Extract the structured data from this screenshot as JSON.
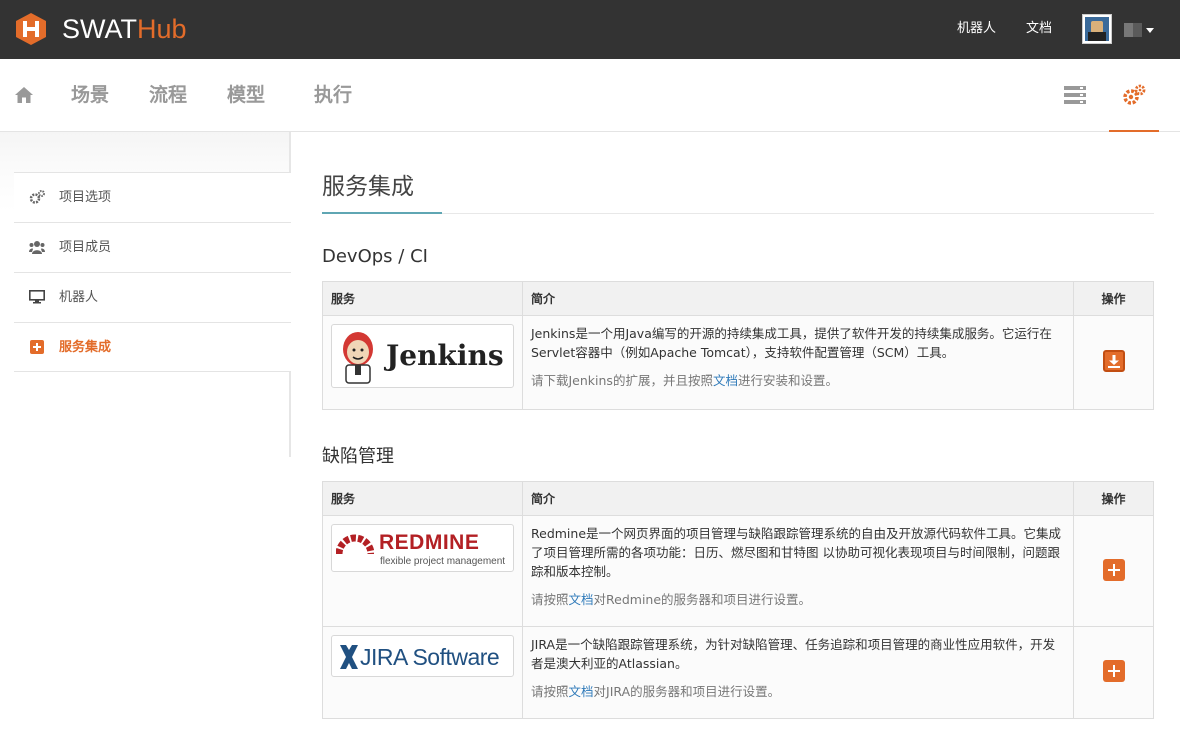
{
  "topbar": {
    "brand_part1": "SWAT",
    "brand_part2": "Hub",
    "link_robot": "机器人",
    "link_docs": "文档"
  },
  "mainnav": {
    "items": [
      "场景",
      "流程",
      "模型",
      "执行"
    ]
  },
  "sidebar": {
    "items": [
      {
        "label": "项目选项",
        "icon": "cogs-icon"
      },
      {
        "label": "项目成员",
        "icon": "users-icon"
      },
      {
        "label": "机器人",
        "icon": "desktop-icon"
      },
      {
        "label": "服务集成",
        "icon": "plus-square-icon",
        "active": true
      }
    ]
  },
  "page": {
    "title": "服务集成"
  },
  "table_headers": {
    "service": "服务",
    "description": "简介",
    "action": "操作"
  },
  "sections": [
    {
      "title": "DevOps / CI",
      "rows": [
        {
          "logo_text": "Jenkins",
          "description": "Jenkins是一个用Java编写的开源的持续集成工具，提供了软件开发的持续集成服务。它运行在Servlet容器中（例如Apache Tomcat），支持软件配置管理（SCM）工具。",
          "hint_before": "请下载Jenkins的扩展，并且按照",
          "hint_link": "文档",
          "hint_after": "进行安装和设置。",
          "action_icon": "download-icon"
        }
      ]
    },
    {
      "title": "缺陷管理",
      "rows": [
        {
          "logo_text": "REDMINE",
          "logo_subtext": "flexible project management",
          "description": "Redmine是一个网页界面的项目管理与缺陷跟踪管理系统的自由及开放源代码软件工具。它集成了项目管理所需的各项功能：日历、燃尽图和甘特图 以协助可视化表现项目与时间限制，问题跟踪和版本控制。",
          "hint_before": "请按照",
          "hint_link": "文档",
          "hint_after": "对Redmine的服务器和项目进行设置。",
          "action_icon": "plus-icon"
        },
        {
          "logo_text": "JIRA Software",
          "description": "JIRA是一个缺陷跟踪管理系统，为针对缺陷管理、任务追踪和项目管理的商业性应用软件，开发者是澳大利亚的Atlassian。",
          "hint_before": "请按照",
          "hint_link": "文档",
          "hint_after": "对JIRA的服务器和项目进行设置。",
          "action_icon": "plus-icon"
        }
      ]
    }
  ],
  "colors": {
    "accent": "#e36c2a",
    "topbar_bg": "#333333",
    "link": "#2f7ab9"
  }
}
